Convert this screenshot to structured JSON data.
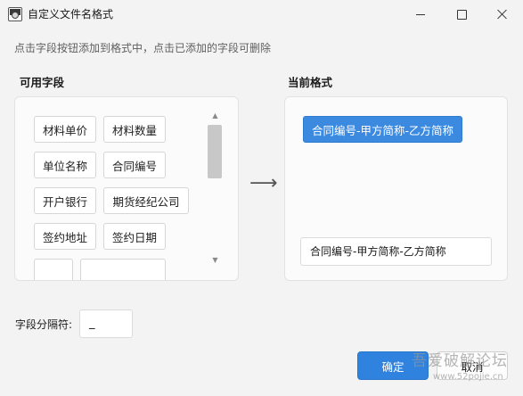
{
  "window": {
    "title": "自定义文件名格式",
    "icon": "app-window-icon",
    "controls": {
      "minimize": "minimize-icon",
      "maximize": "maximize-icon",
      "close": "close-icon"
    }
  },
  "hint": "点击字段按钮添加到格式中，点击已添加的字段可删除",
  "available": {
    "label": "可用字段",
    "fields": [
      "材料单价",
      "材料数量",
      "单位名称",
      "合同编号",
      "开户银行",
      "期货经纪公司",
      "签约地址",
      "签约日期",
      "",
      ""
    ]
  },
  "arrow": "⟶",
  "current": {
    "label": "当前格式",
    "chip": "合同编号-甲方简称-乙方简称",
    "preview": "合同编号-甲方简称-乙方简称"
  },
  "separator": {
    "label": "字段分隔符:",
    "value": "_"
  },
  "buttons": {
    "ok": "确定",
    "cancel": "取消"
  },
  "watermark": {
    "main": "吾爱破解论坛",
    "sub": "www.52pojie.cn"
  },
  "colors": {
    "accent": "#2f82de",
    "chip_selected": "#3b8ae0"
  }
}
